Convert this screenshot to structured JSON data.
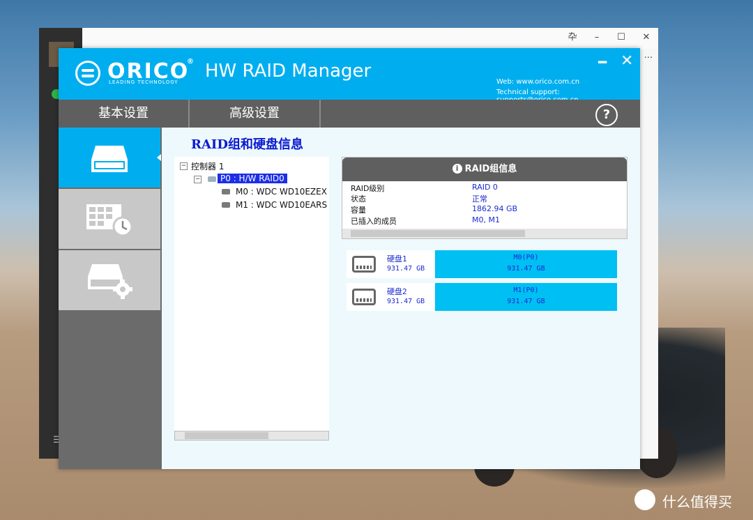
{
  "background_app": {
    "controls": [
      "卆",
      "–",
      "☐",
      "✕"
    ],
    "menu_dots": "···",
    "bottom_icon": "☰"
  },
  "app": {
    "brand": "ORICO",
    "brand_reg": "®",
    "brand_tagline": "LEADING TECHNOLOGY",
    "title": "HW RAID Manager",
    "web": "Web: www.orico.com.cn",
    "support": "Technical support: supports@orico.com.cn",
    "minimize": "━",
    "close": "✕"
  },
  "tabs": [
    {
      "label": "基本设置"
    },
    {
      "label": "高级设置"
    }
  ],
  "help_label": "?",
  "content": {
    "title": "RAID组和硬盘信息"
  },
  "tree": {
    "controller": "控制器 1",
    "raid": "P0 : H/W RAID0",
    "members": [
      "M0 : WDC WD10EZEX",
      "M1 : WDC WD10EARS"
    ]
  },
  "info": {
    "header": "RAID组信息",
    "rows": [
      {
        "label": "RAID级别",
        "value": "RAID 0"
      },
      {
        "label": "状态",
        "value": "正常"
      },
      {
        "label": "容量",
        "value": "1862.94 GB"
      },
      {
        "label": "已插入的成员",
        "value": "M0, M1"
      }
    ]
  },
  "disks": [
    {
      "name": "硬盘1",
      "size": "931.47 GB",
      "member": "M0(P0)",
      "member_size": "931.47 GB"
    },
    {
      "name": "硬盘2",
      "size": "931.47 GB",
      "member": "M1(P0)",
      "member_size": "931.47 GB"
    }
  ],
  "watermark": "什么值得买",
  "colors": {
    "accent": "#00aeef",
    "tab_bar": "#5f5f5f",
    "text_blue": "#1a2ad0",
    "disk_bar": "#00bff3"
  }
}
